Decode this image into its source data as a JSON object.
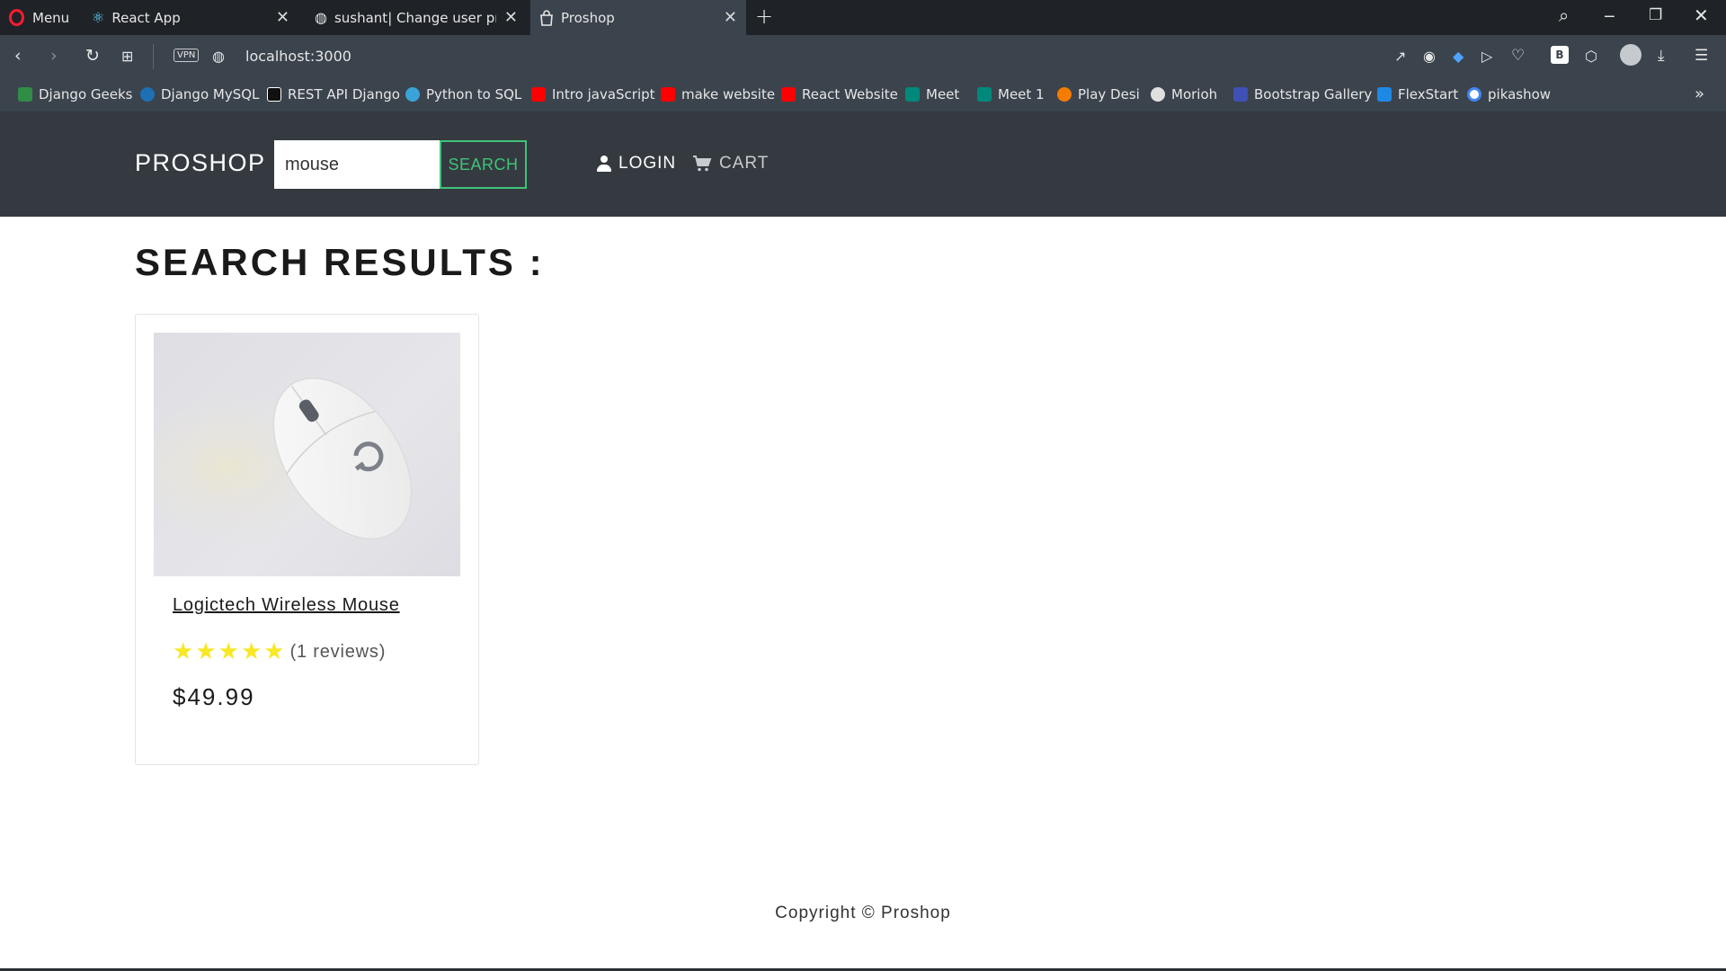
{
  "browser": {
    "menu_label": "Menu",
    "tabs": [
      {
        "label": "React App"
      },
      {
        "label": "sushant| Change user profi"
      },
      {
        "label": "Proshop"
      }
    ],
    "url": "localhost:3000",
    "vpn_label": "VPN",
    "bookmarks": [
      {
        "label": "Django Geeks",
        "color": "#2f8d46"
      },
      {
        "label": "Django MySQL",
        "color": "#1f6fb5"
      },
      {
        "label": "REST API Django",
        "color": "#111111"
      },
      {
        "label": "Python to SQL",
        "color": "#3aa3d8"
      },
      {
        "label": "Intro javaScript",
        "color": "#ff0000"
      },
      {
        "label": "make website",
        "color": "#ff0000"
      },
      {
        "label": "React Website",
        "color": "#ff0000"
      },
      {
        "label": "Meet",
        "color": "#00897b"
      },
      {
        "label": "Meet 1",
        "color": "#00897b"
      },
      {
        "label": "Play Desi",
        "color": "#f57c00"
      },
      {
        "label": "Morioh",
        "color": "#e0e0e0"
      },
      {
        "label": "Bootstrap Gallery",
        "color": "#3f51b5"
      },
      {
        "label": "FlexStart",
        "color": "#1e88e5"
      },
      {
        "label": "pikashow",
        "color": "#4285f4"
      }
    ]
  },
  "navbar": {
    "brand": "PROSHOP",
    "search_value": "mouse",
    "search_button": "SEARCH",
    "login": "LOGIN",
    "cart": "CART"
  },
  "main": {
    "title": "SEARCH RESULTS :",
    "products": [
      {
        "name": "Logictech Wireless Mouse",
        "rating": 5,
        "reviews_text": "(1 reviews)",
        "price": "$49.99"
      }
    ]
  },
  "footer": {
    "text": "Copyright © Proshop"
  },
  "colors": {
    "navbar_bg": "#343a40",
    "search_accent": "#3fc379",
    "star": "#f8e825"
  }
}
